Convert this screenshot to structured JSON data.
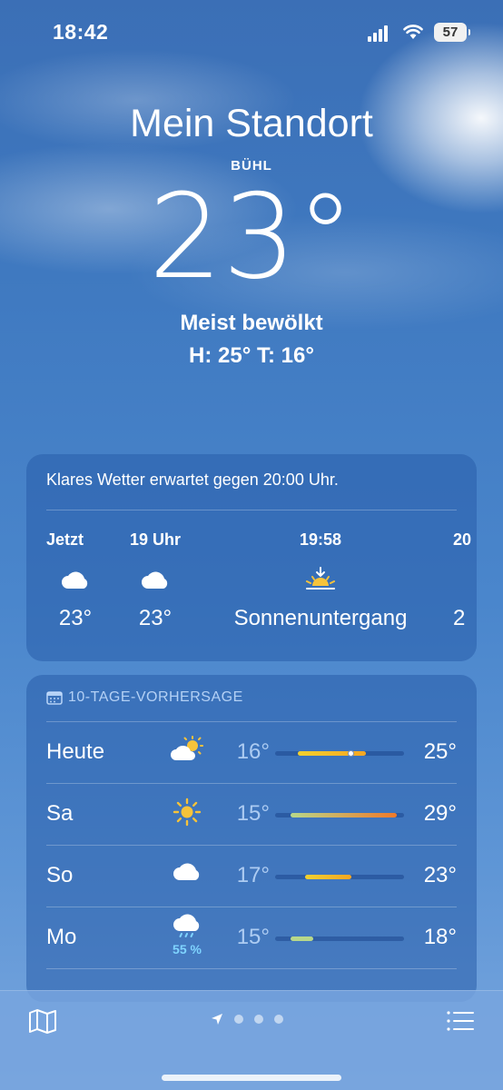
{
  "status_bar": {
    "time": "18:42",
    "battery": "57"
  },
  "header": {
    "location": "Mein Standort",
    "sublocation": "BÜHL",
    "temperature": "23°",
    "condition": "Meist bewölkt",
    "high_low": "H: 25°  T: 16°"
  },
  "hourly": {
    "summary": "Klares Wetter erwartet gegen 20:00 Uhr.",
    "items": [
      {
        "label": "Jetzt",
        "icon": "cloud-icon",
        "value": "23°"
      },
      {
        "label": "19 Uhr",
        "icon": "cloud-icon",
        "value": "23°"
      },
      {
        "label": "19:58",
        "icon": "sunset-icon",
        "value": "Sonnenuntergang"
      },
      {
        "label": "20",
        "icon": "moon-icon",
        "value": "2"
      }
    ]
  },
  "forecast": {
    "title": "10-TAGE-VORHERSAGE",
    "days": [
      {
        "day": "Heute",
        "icon": "partly-cloudy-icon",
        "low": "16°",
        "high": "25°",
        "pop": "",
        "range": [
          16,
          25
        ],
        "current": 23
      },
      {
        "day": "Sa",
        "icon": "sun-icon",
        "low": "15°",
        "high": "29°",
        "pop": "",
        "range": [
          15,
          29
        ]
      },
      {
        "day": "So",
        "icon": "cloud-icon",
        "low": "17°",
        "high": "23°",
        "pop": "",
        "range": [
          17,
          23
        ]
      },
      {
        "day": "Mo",
        "icon": "rain-cloud-icon",
        "low": "15°",
        "high": "18°",
        "pop": "55 %",
        "range": [
          15,
          18
        ]
      }
    ],
    "scale_min": 13,
    "scale_max": 30
  },
  "bottom_bar": {
    "map": "map-icon",
    "list": "list-icon"
  },
  "colors": {
    "cool": "#b8d88a",
    "mild": "#f2d12e",
    "warm": "#f5a623",
    "hot": "#f07a2a"
  }
}
